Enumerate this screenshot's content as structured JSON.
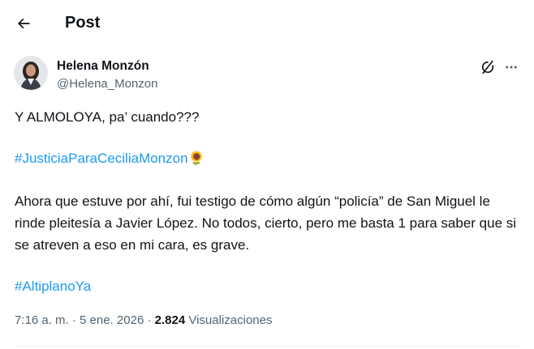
{
  "header": {
    "title": "Post",
    "back_icon": "arrow-left-icon"
  },
  "author": {
    "name": "Helena Monzón",
    "handle": "@Helena_Monzon",
    "avatar_icon": "profile-photo"
  },
  "actions": {
    "grok_icon": "grok-icon",
    "more_icon": "more-horizontal-icon"
  },
  "post": {
    "line1": "Y ALMOLOYA, pa’ cuando???",
    "hashtag1": "#JusticiaParaCeciliaMonzon",
    "emoji1": "🌻",
    "paragraph": "Ahora que estuve por ahí, fui testigo de cómo algún “policía” de San Miguel le rinde pleitesía a Javier López. No todos, cierto, pero me basta 1 para saber que si se atreven a eso en mi cara, es grave.",
    "hashtag2": "#AltiplanoYa"
  },
  "meta": {
    "time": "7:16 a. m.",
    "sep1": " · ",
    "date": "5 ene. 2026",
    "sep2": " · ",
    "views": "2.824",
    "views_label": " Visualizaciones"
  },
  "colors": {
    "link": "#1d9bf0",
    "secondary": "#536471",
    "text": "#0f1419"
  }
}
